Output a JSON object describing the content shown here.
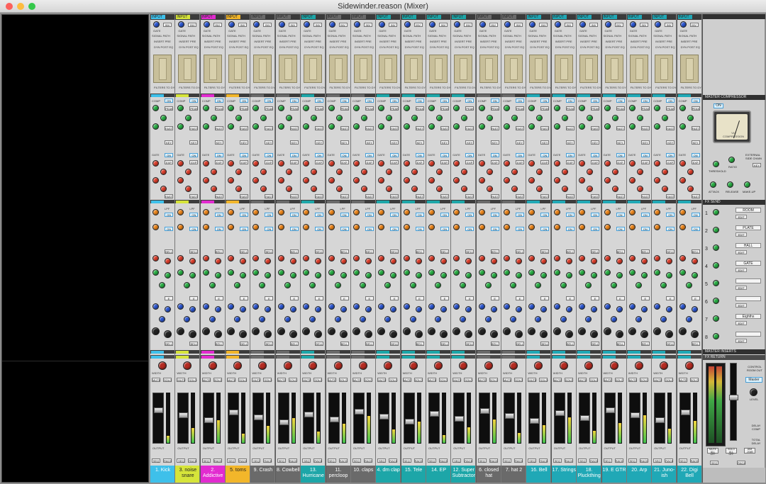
{
  "window": {
    "title": "Sidewinder.reason (Mixer)"
  },
  "colors": {
    "kick": "#3ec0ea",
    "yellow": "#d6e43a",
    "magenta": "#e22bd0",
    "orange": "#f2b62a",
    "gray": "#6a6a6a",
    "teal": "#1da6a8",
    "teal2": "#20a8b6"
  },
  "channel_strip": {
    "input": "INPUT",
    "inv": "INV",
    "gate": "GATE",
    "signal_path": "SIGNAL PATH",
    "insert_pre": "INSERT PRE",
    "dyn_post_eq": "DYN POST EQ",
    "filters_to_dyn_sc": "FILTERS TO DYN S/C",
    "dynamics": "DYNAMICS",
    "comp": "COMP",
    "on": "ON",
    "peak": "PEAK",
    "ratio": "RATIO",
    "thres": "THRES",
    "rel": "REL",
    "fast": "FAST",
    "key": "KEY",
    "exp": "EXP",
    "range": "RANGE",
    "hold": "HOLD",
    "eq": "EQ",
    "lpf": "LPF",
    "hpf": "HPF",
    "bell": "BELL",
    "hmf": "HMF",
    "hf": "HF",
    "lmf": "LMF",
    "lf": "LF",
    "freq": "FREQ",
    "gain": "GAIN",
    "q": "Q",
    "e": "E",
    "inserts": "INSERTS",
    "send": "SEND",
    "width": "WIDTH",
    "mute": "MUTE",
    "solo": "SOLO",
    "mono": "MONO",
    "output": "OUTPUT",
    "seq": "SEQ",
    "rack": "RACK"
  },
  "channels": [
    {
      "label": "1. Kick",
      "color": "#3ec0ea"
    },
    {
      "label": "3. noise snare",
      "color": "#d6e43a"
    },
    {
      "label": "2. Addictive",
      "color": "#e22bd0"
    },
    {
      "label": "5. toms",
      "color": "#f2b62a"
    },
    {
      "label": "9. Crash",
      "color": "#6a6a6a"
    },
    {
      "label": "8. Cowbell",
      "color": "#6a6a6a"
    },
    {
      "label": "13. Hurricane",
      "color": "#1da6a8"
    },
    {
      "label": "11. percloop",
      "color": "#6a6a6a"
    },
    {
      "label": "10. claps",
      "color": "#6a6a6a"
    },
    {
      "label": "4. dm clap",
      "color": "#1da6a8"
    },
    {
      "label": "15. Tele",
      "color": "#1da6a8"
    },
    {
      "label": "14. EP",
      "color": "#1da6a8"
    },
    {
      "label": "12. Super Subtractor",
      "color": "#1da6a8"
    },
    {
      "label": "6. closed hat",
      "color": "#6a6a6a"
    },
    {
      "label": "7. hat 2",
      "color": "#6a6a6a"
    },
    {
      "label": "16. Bell",
      "color": "#20a8b6"
    },
    {
      "label": "17. Strings",
      "color": "#20a8b6"
    },
    {
      "label": "18. Pluckthing",
      "color": "#20a8b6"
    },
    {
      "label": "19. E GTR",
      "color": "#20a8b6"
    },
    {
      "label": "20. Arp",
      "color": "#20a8b6"
    },
    {
      "label": "21. Juno-ish",
      "color": "#20a8b6"
    },
    {
      "label": "22. Digi Bell",
      "color": "#20a8b6"
    }
  ],
  "master": {
    "master_compressor": "MASTER COMPRESSOR",
    "on": "ON",
    "vu_label": "VU COMPRESSION",
    "threshold": "THRESHOLD",
    "ratio": "RATIO",
    "attack": "ATTACK",
    "release": "RELEASE",
    "make_up": "MAKE-UP",
    "external_sidechain": "EXTERNAL SIDE CHAIN",
    "key": "KEY",
    "fx_send": "FX SEND",
    "fx": [
      {
        "num": "1",
        "name": "ROOM",
        "edit": "EDIT"
      },
      {
        "num": "2",
        "name": "PLATE",
        "edit": "EDIT"
      },
      {
        "num": "3",
        "name": "HALL",
        "edit": "EDIT"
      },
      {
        "num": "4",
        "name": "GATE",
        "edit": "EDIT"
      },
      {
        "num": "5",
        "name": "",
        "edit": "EDIT"
      },
      {
        "num": "6",
        "name": "",
        "edit": "EDIT"
      },
      {
        "num": "7",
        "name": "Eighths",
        "edit": "EDIT"
      },
      {
        "num": "8",
        "name": "",
        "edit": "EDIT"
      }
    ],
    "master_inserts": "MASTER INSERTS",
    "fx_return": "FX RETURN",
    "control_room_out": "CONTROL ROOM OUT",
    "master_btn": "Master",
    "level": "LEVEL",
    "delay_comp": "DELAY COMP",
    "total_delay": "TOTAL DELAY",
    "mute_all_off": "MUTE ALL OFF",
    "solo_all_off": "SOLO ALL OFF",
    "dim": "DIM -20dB",
    "seq": "SEQ",
    "rack": "RACK"
  }
}
